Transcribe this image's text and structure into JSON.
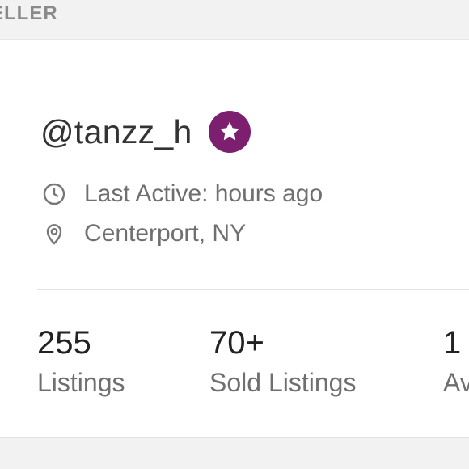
{
  "section": {
    "label": "ELLER"
  },
  "seller": {
    "username": "@tanzz_h",
    "badge_icon": "star-badge-icon",
    "badge_color": "#7d1f6f",
    "last_active": "Last Active: hours ago",
    "location": "Centerport, NY"
  },
  "stats": [
    {
      "value": "255",
      "label": "Listings"
    },
    {
      "value": "70+",
      "label": "Sold Listings"
    },
    {
      "value": "1",
      "label": "Av"
    }
  ],
  "icons": {
    "active": "clock-icon",
    "location": "location-pin-icon"
  }
}
